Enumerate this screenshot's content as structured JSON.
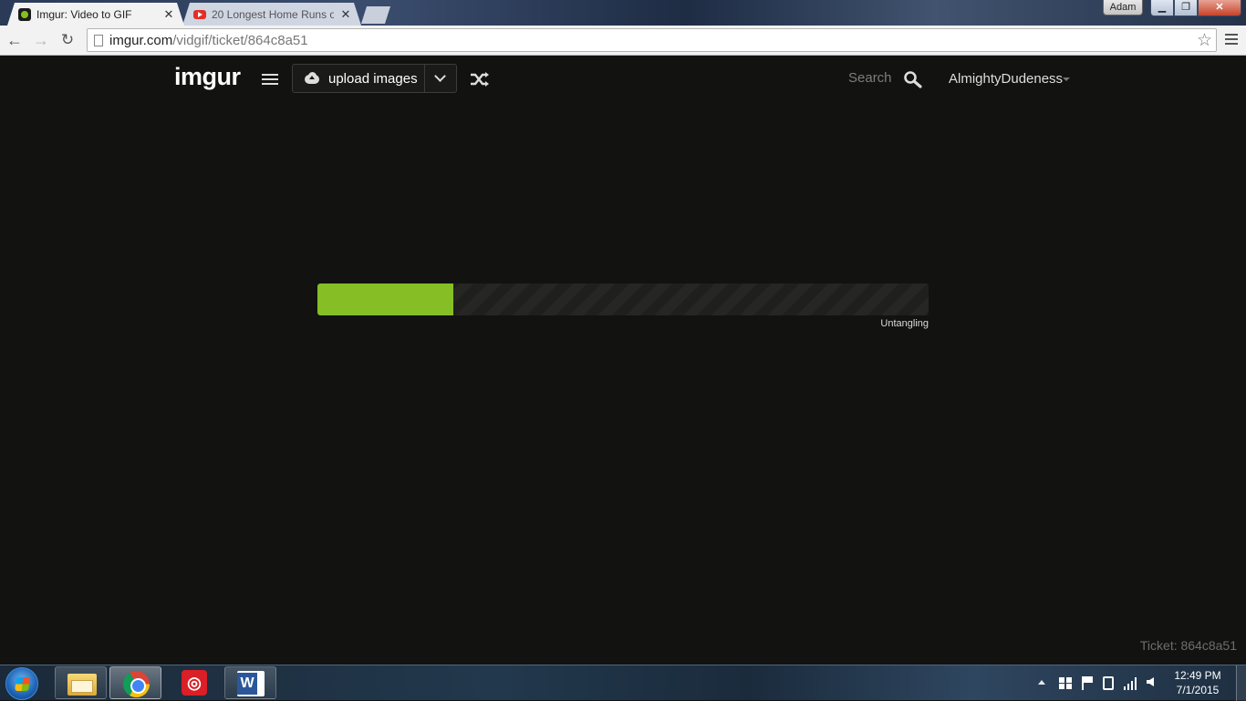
{
  "browser": {
    "tabs": [
      {
        "title": "Imgur: Video to GIF",
        "active": true,
        "favicon": "imgur-icon"
      },
      {
        "title": "20 Longest Home Runs of",
        "active": false,
        "favicon": "youtube-icon"
      }
    ],
    "user_badge": "Adam",
    "url_domain": "imgur.com",
    "url_path": "/vidgif/ticket/864c8a51"
  },
  "imgur": {
    "logo": "imgur",
    "upload_label": "upload images",
    "search_label": "Search",
    "username": "AlmightyDudeness",
    "progress": {
      "fraction": 0.222,
      "status": "Untangling"
    },
    "ticket": "Ticket: 864c8a51",
    "colors": {
      "accent": "#85bf25",
      "background": "#121211"
    }
  },
  "taskbar": {
    "apps": [
      "windows-explorer-icon",
      "chrome-icon",
      "adobe-creative-cloud-icon",
      "word-icon"
    ],
    "time": "12:49 PM",
    "date": "7/1/2015"
  }
}
